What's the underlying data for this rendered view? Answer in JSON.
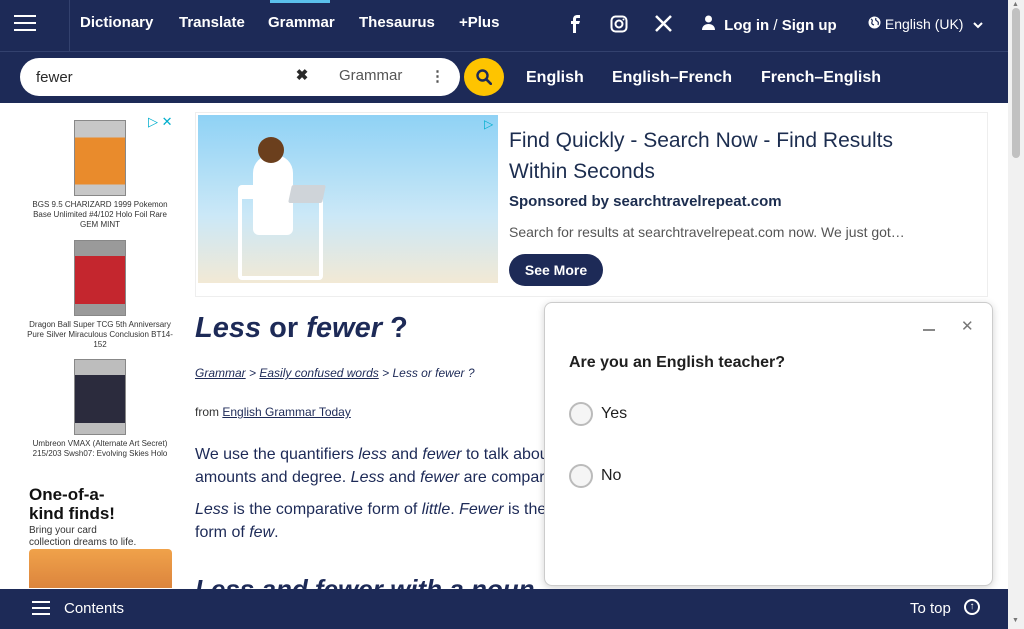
{
  "nav": {
    "links": [
      "Dictionary",
      "Translate",
      "Grammar",
      "Thesaurus",
      "+Plus"
    ],
    "login": "Log in",
    "slash": "/",
    "signup": "Sign up",
    "language": "English (UK)",
    "social_icons": [
      "facebook-icon",
      "instagram-icon",
      "x-icon"
    ]
  },
  "search": {
    "value": "fewer",
    "dictionary": "Grammar",
    "tabs": [
      "English",
      "English–French",
      "French–English"
    ]
  },
  "left_ad": {
    "items": [
      "BGS 9.5 CHARIZARD 1999 Pokemon Base Unlimited #4/102 Holo Foil Rare GEM MINT",
      "Dragon Ball Super TCG 5th Anniversary Pure Silver Miraculous Conclusion BT14-152",
      "Umbreon VMAX (Alternate Art Secret) 215/203 Swsh07: Evolving Skies Holo"
    ],
    "promo_title": "One-of-a-kind finds!",
    "promo_sub": "Bring your card collection dreams to life."
  },
  "top_ad": {
    "title": "Find Quickly - Search Now - Find Results Within Seconds",
    "sponsor": "Sponsored by searchtravelrepeat.com",
    "description": "Search for results at searchtravelrepeat.com now. We just got…",
    "button": "See More"
  },
  "article": {
    "title_word1": "Less",
    "title_or": "or",
    "title_word2": "fewer",
    "title_q": "?",
    "breadcrumb": {
      "grammar": "Grammar",
      "sep": ">",
      "confused": "Easily confused words",
      "current": "Less or fewer ?"
    },
    "from_label": "from",
    "from_link": "English Grammar Today",
    "para1": {
      "t1": "We use the quantifiers ",
      "w1": "less",
      "t2": " and ",
      "w2": "fewer",
      "t3": " to talk abou",
      "t4": "amounts and degree. ",
      "w3": "Less",
      "t5": " and ",
      "w4": "fewer",
      "t6": " are compar"
    },
    "para2": {
      "w1": "Less",
      "t1": " is the comparative form of ",
      "w2": "little",
      "t2": ". ",
      "w3": "Fewer",
      "t3": " is the",
      "t4": "form of ",
      "w4": "few",
      "t5": "."
    },
    "sub_heading": "Less and fewer with a noun"
  },
  "survey": {
    "question": "Are you an English teacher?",
    "options": [
      "Yes",
      "No"
    ]
  },
  "footer": {
    "contents": "Contents",
    "to_top": "To top"
  },
  "colors": {
    "navy": "#1d2a57",
    "search_button": "#fec400",
    "accent": "#5bc0eb"
  }
}
